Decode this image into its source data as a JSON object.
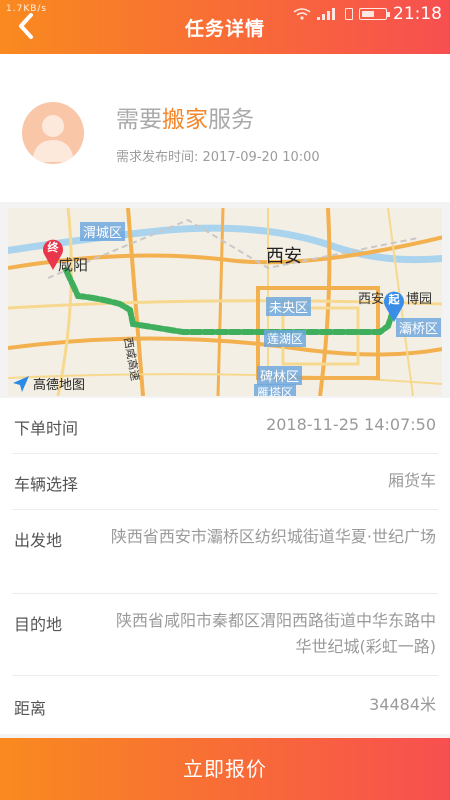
{
  "status_bar": {
    "network": "1.7KB/s",
    "time": "21:18"
  },
  "header": {
    "title": "任务详情",
    "back_icon": "chevron-left-icon"
  },
  "service": {
    "title_prefix": "需要",
    "title_highlight": "搬家",
    "title_suffix": "服务",
    "publish_time": "需求发布时间: 2017-09-20 10:00"
  },
  "map": {
    "labels": {
      "weicheng": "渭城区",
      "xianyang": "咸阳",
      "xian": "西安",
      "weiyang": "未央区",
      "lianhu": "莲湖区",
      "beilin": "碑林区",
      "yanta": "雁塔区",
      "xiyan": "西安",
      "bowuyuan": "博园",
      "baqiao": "灞桥区",
      "highway": "西咸高速"
    },
    "start_pin": "起",
    "end_pin": "终",
    "logo": "高德地图"
  },
  "details": {
    "order_time": {
      "label": "下单时间",
      "value": "2018-11-25 14:07:50"
    },
    "vehicle": {
      "label": "车辆选择",
      "value": "厢货车"
    },
    "origin": {
      "label": "出发地",
      "value": "陕西省西安市灞桥区纺织城街道华夏·世纪广场"
    },
    "destination": {
      "label": "目的地",
      "value": "陕西省咸阳市秦都区渭阳西路街道中华东路中华世纪城(彩虹一路)"
    },
    "distance": {
      "label": "距离",
      "value": "34484米"
    }
  },
  "action": {
    "quote_label": "立即报价"
  },
  "colors": {
    "accent": "#f86a38",
    "highlight": "#f5862a",
    "route": "#3fae5d"
  }
}
